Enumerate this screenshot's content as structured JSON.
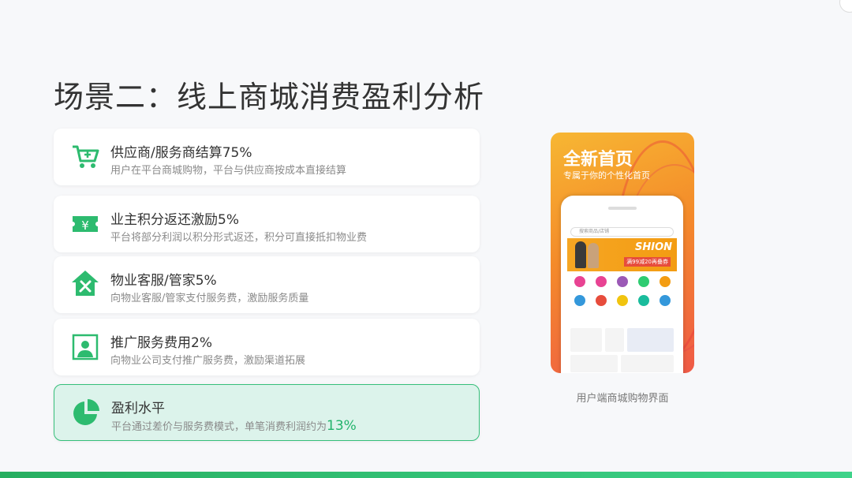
{
  "title": "场景二：线上商城消费盈利分析",
  "cards": [
    {
      "head": "供应商/服务商结算75%",
      "sub": "用户在平台商城购物，平台与供应商按成本直接结算",
      "icon": "cart-plus-icon"
    },
    {
      "head": "业主积分返还激励5%",
      "sub": "平台将部分利润以积分形式返还，积分可直接抵扣物业费",
      "icon": "yen-ticket-icon"
    },
    {
      "head": "物业客服/管家5%",
      "sub": "向物业客服/管家支付服务费，激励服务质量",
      "icon": "house-tools-icon"
    },
    {
      "head": "推广服务费用2%",
      "sub": "向物业公司支付推广服务费，激励渠道拓展",
      "icon": "person-frame-icon"
    }
  ],
  "highlight": {
    "head": "盈利水平",
    "sub": "平台通过差价与服务费模式，单笔消费利润约为",
    "pct": "13%",
    "icon": "pie-chart-icon"
  },
  "phone": {
    "title": "全新首页",
    "subtitle": "专属于你的个性化首页",
    "search_placeholder": "搜索商品/店铺",
    "banner_text": "SHION",
    "banner_badge": "满99减20再叠券"
  },
  "caption": "用户端商城购物界面",
  "colors": {
    "accent": "#22b36b",
    "highlight_bg": "#dcf3eb",
    "icon_green": "#2dbb6f"
  }
}
